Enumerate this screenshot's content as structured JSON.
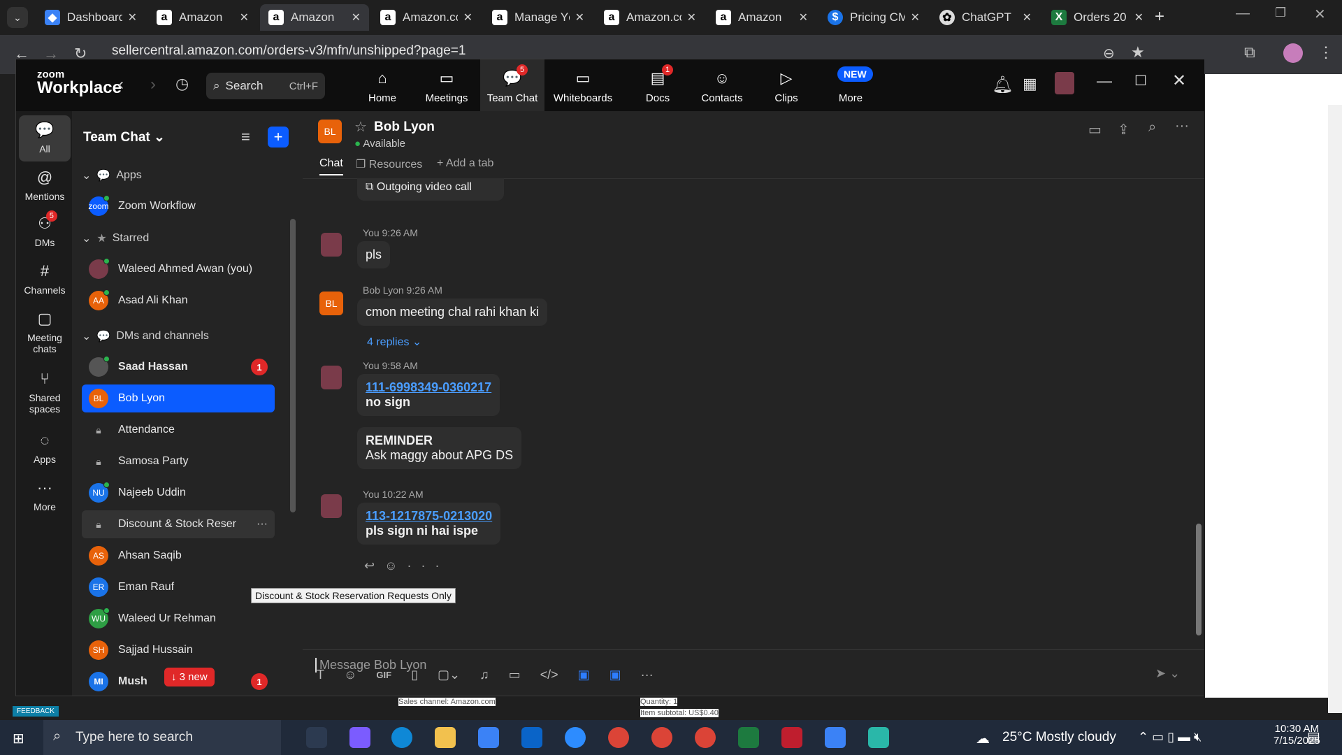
{
  "browser": {
    "tabs": [
      {
        "label": "Dashboard",
        "icon": "dashboard-icon"
      },
      {
        "label": "Amazon",
        "icon": "amazon-icon"
      },
      {
        "label": "Amazon",
        "icon": "amazon-icon",
        "active": true
      },
      {
        "label": "Amazon.cc",
        "icon": "amazon-icon"
      },
      {
        "label": "Manage Yc",
        "icon": "amazon-icon"
      },
      {
        "label": "Amazon.cc",
        "icon": "amazon-icon"
      },
      {
        "label": "Amazon",
        "icon": "amazon-icon"
      },
      {
        "label": "Pricing CM",
        "icon": "dollar-icon"
      },
      {
        "label": "ChatGPT",
        "icon": "chatgpt-icon"
      },
      {
        "label": "Orders 20",
        "icon": "excel-icon"
      }
    ],
    "url": "sellercentral.amazon.com/orders-v3/mfn/unshipped?page=1"
  },
  "zoom": {
    "logo_top": "zoom",
    "logo_bottom": "Workplace",
    "search_label": "Search",
    "search_shortcut": "Ctrl+F",
    "nav": [
      {
        "label": "Home"
      },
      {
        "label": "Meetings"
      },
      {
        "label": "Team Chat",
        "badge": "5"
      },
      {
        "label": "Whiteboards"
      },
      {
        "label": "Docs",
        "badge": "1"
      },
      {
        "label": "Contacts"
      },
      {
        "label": "Clips"
      },
      {
        "label": "More"
      }
    ],
    "new_badge": "NEW",
    "rail": [
      {
        "label": "All"
      },
      {
        "label": "Mentions"
      },
      {
        "label": "DMs",
        "badge": "5"
      },
      {
        "label": "Channels"
      },
      {
        "label": "Meeting chats"
      },
      {
        "label": "Shared spaces"
      },
      {
        "label": "Apps"
      },
      {
        "label": "More"
      }
    ],
    "sidebar": {
      "title": "Team Chat",
      "sections": {
        "apps": "Apps",
        "starred": "Starred",
        "dms": "DMs and channels"
      },
      "apps": [
        {
          "name": "Zoom Workflow",
          "avatar": "zoom"
        }
      ],
      "starred": [
        {
          "name": "Waleed Ahmed Awan (you)"
        },
        {
          "name": "Asad Ali Khan",
          "initials": "AA"
        }
      ],
      "dms": [
        {
          "name": "Saad Hassan",
          "badge": "1",
          "bold": true
        },
        {
          "name": "Bob Lyon",
          "initials": "BL",
          "selected": true
        },
        {
          "name": "Attendance",
          "locked": true
        },
        {
          "name": "Samosa Party",
          "locked": true
        },
        {
          "name": "Najeeb Uddin",
          "initials": "NU"
        },
        {
          "name": "Discount & Stock Reser",
          "locked": true,
          "hover": true
        },
        {
          "name": "Ahsan Saqib",
          "initials": "AS"
        },
        {
          "name": "Eman Rauf",
          "initials": "ER"
        },
        {
          "name": "Waleed Ur Rehman",
          "initials": "WU"
        },
        {
          "name": "Sajjad Hussain",
          "initials": "SH"
        },
        {
          "name": "Mush",
          "initials": "MI",
          "badge": "1",
          "bold": true
        }
      ],
      "new_pill": "↓ 3 new",
      "tooltip": "Discount & Stock Reservation Requests Only"
    },
    "chat": {
      "contact_name": "Bob Lyon",
      "contact_initials": "BL",
      "status": "Available",
      "tabs": [
        "Chat",
        "Resources",
        "+ Add a tab"
      ],
      "messages": {
        "m0": "Outgoing video call",
        "m1_meta": "You 9:26 AM",
        "m1_text": "pls",
        "m2_meta": "Bob Lyon 9:26 AM",
        "m2_text": "cmon meeting chal rahi khan ki",
        "m2_replies": "4 replies",
        "m3_meta": "You 9:58 AM",
        "m3_link": "111-6998349-0360217",
        "m3_text": "no sign",
        "m4_title": "REMINDER",
        "m4_text": "Ask maggy about APG DS",
        "m5_meta": "You 10:22 AM",
        "m5_link": "113-1217875-0213020",
        "m5_text": "pls sign ni hai ispe"
      },
      "composer_placeholder": "Message Bob Lyon"
    }
  },
  "page_behind": {
    "sales_channel": "Sales channel: Amazon.com",
    "quantity": "Quantity: 1",
    "subtotal": "Item subtotal: US$0.40",
    "feedback": "FEEDBACK"
  },
  "taskbar": {
    "search_placeholder": "Type here to search",
    "weather": "25°C  Mostly cloudy",
    "time": "10:30 AM",
    "date": "7/15/2025"
  }
}
